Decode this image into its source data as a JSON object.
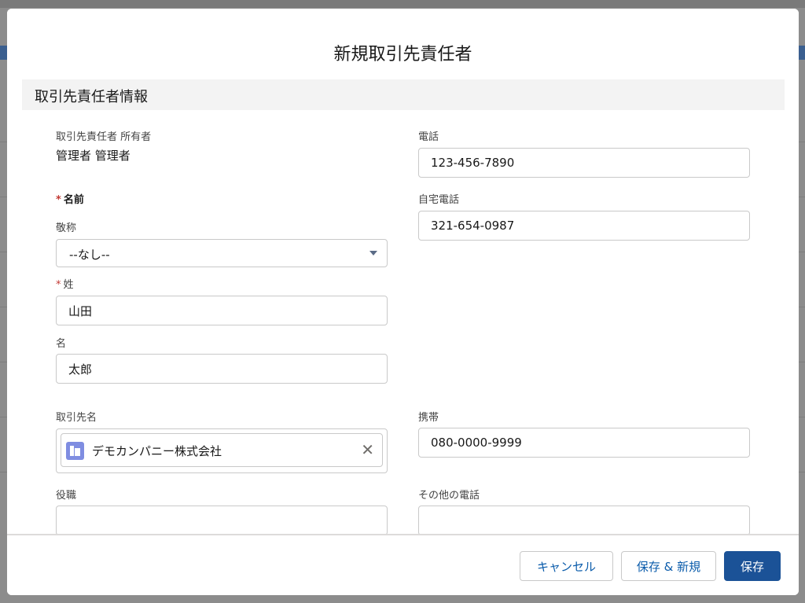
{
  "modal": {
    "title": "新規取引先責任者",
    "section_title": "取引先責任者情報"
  },
  "fields": {
    "owner": {
      "label": "取引先責任者 所有者",
      "value": "管理者 管理者"
    },
    "name_group": {
      "required_mark": "*",
      "label": "名前"
    },
    "salutation": {
      "label": "敬称",
      "value": "--なし--"
    },
    "last_name": {
      "required_mark": "*",
      "label": "姓",
      "value": "山田"
    },
    "first_name": {
      "label": "名",
      "value": "太郎"
    },
    "account_name": {
      "label": "取引先名",
      "value": "デモカンパニー株式会社"
    },
    "title": {
      "label": "役職",
      "value": ""
    },
    "phone": {
      "label": "電話",
      "value": "123-456-7890"
    },
    "home_phone": {
      "label": "自宅電話",
      "value": "321-654-0987"
    },
    "mobile": {
      "label": "携帯",
      "value": "080-0000-9999"
    },
    "other_phone": {
      "label": "その他の電話",
      "value": ""
    }
  },
  "footer": {
    "cancel_label": "キャンセル",
    "save_new_label": "保存 & 新規",
    "save_label": "保存"
  },
  "icons": {
    "account": "building-icon",
    "remove": "close-icon",
    "dropdown": "chevron-down-icon"
  },
  "colors": {
    "brand": "#1b5297",
    "link": "#0b5cab",
    "required": "#c23934",
    "account_icon": "#7f8de1"
  }
}
